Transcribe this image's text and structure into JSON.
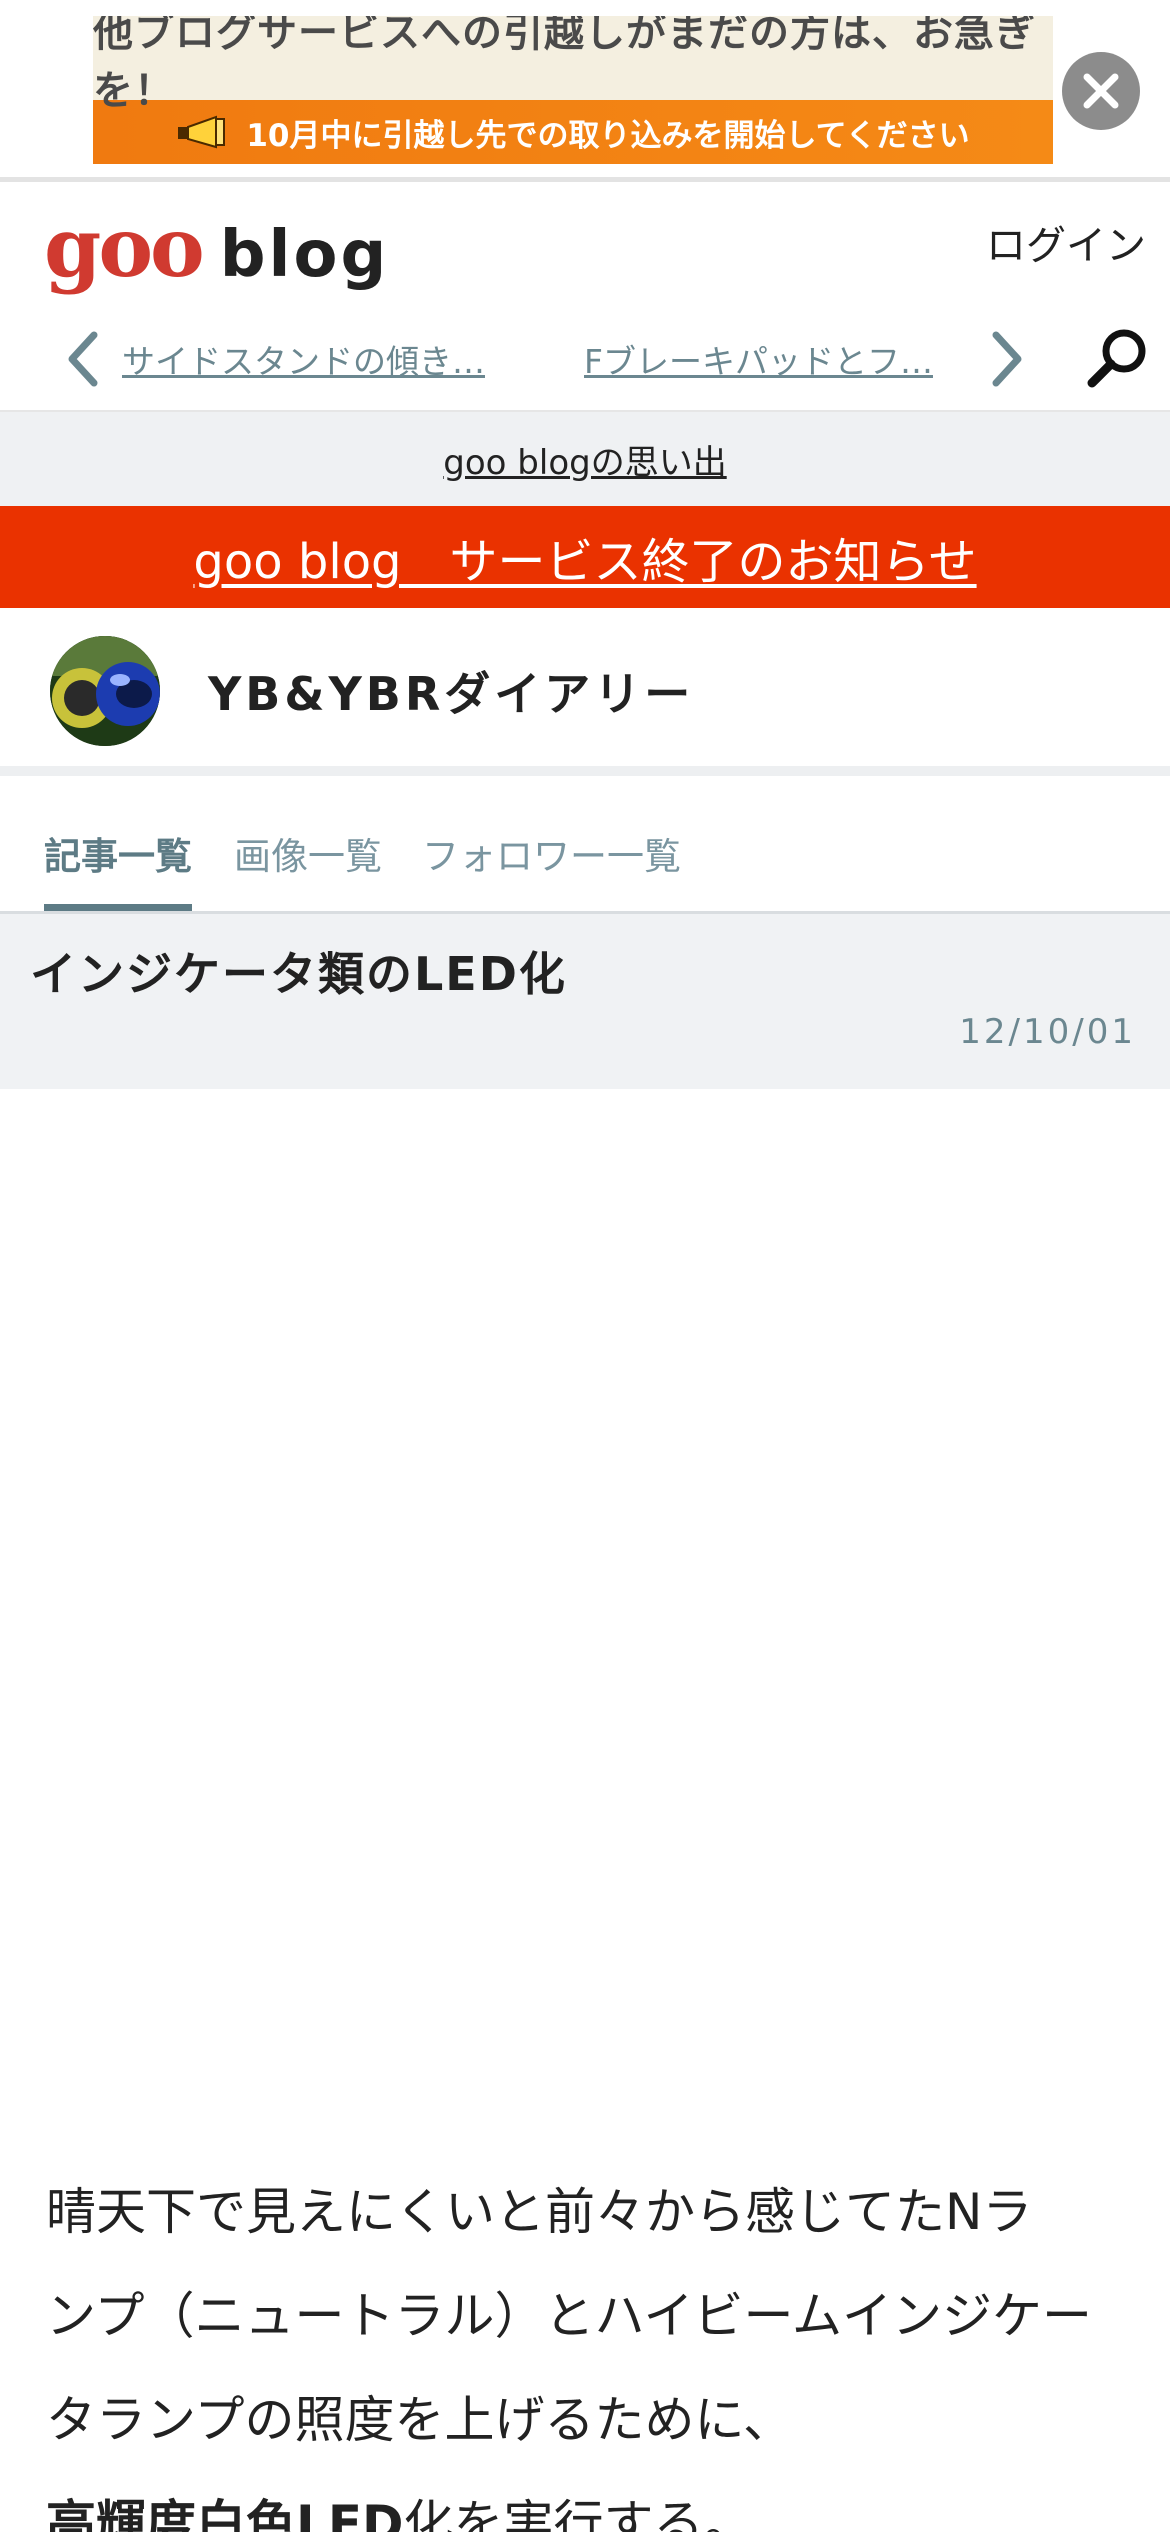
{
  "ad": {
    "headline": "他ブログサービスへの引越しがまだの方は、お急ぎを！",
    "subline": "10月中に引越し先での取り込みを開始してください",
    "close_icon": "close-icon"
  },
  "header": {
    "logo_goo": "goo",
    "logo_blog": "blog",
    "login_label": "ログイン",
    "prev_article": "サイドスタンドの傾き…",
    "next_article": "Fブレーキパッドとフ…",
    "search_icon": "search-icon"
  },
  "memories_link": "goo blogの思い出",
  "service_end_link": "goo blog　サービス終了のお知らせ",
  "blog": {
    "title": "YB&YBRダイアリー"
  },
  "tabs": [
    {
      "label": "記事一覧",
      "active": true
    },
    {
      "label": "画像一覧",
      "active": false
    },
    {
      "label": "フォロワー一覧",
      "active": false
    }
  ],
  "article": {
    "title": "インジケータ類のLED化",
    "date": "12/10/01",
    "body_lines": [
      "晴天下で見えにくいと前々から感じてたNラ",
      "ンプ（ニュートラル）とハイビームインジケー",
      "タランプの照度を上げるために、"
    ],
    "body_bold": "高輝度白色LED",
    "body_tail": "化を実行する。"
  },
  "colors": {
    "accent": "#5d7b85",
    "end_banner": "#ea3200",
    "logo_red": "#d03a30"
  }
}
